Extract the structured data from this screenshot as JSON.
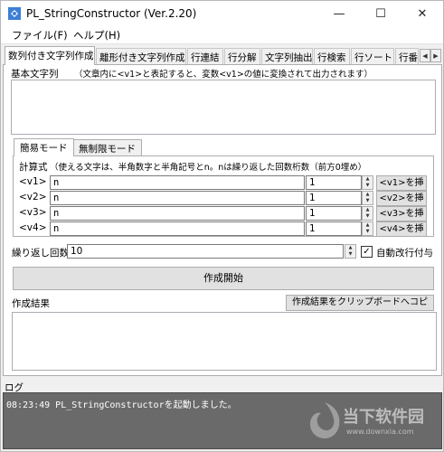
{
  "window": {
    "title": "PL_StringConstructor (Ver.2.20)",
    "minimize": "—",
    "maximize": "☐",
    "close": "✕"
  },
  "menu": {
    "file": "ファイル(F)",
    "help": "ヘルプ(H)"
  },
  "tabs": [
    "数列付き文字列作成",
    "離形付き文字列作成",
    "行連結",
    "行分解",
    "文字列抽出",
    "行検索",
    "行ソート",
    "行番"
  ],
  "main": {
    "base_label": "基本文字列",
    "base_hint": "（文章内に<v1>と表記すると、変数<v1>の値に変換されて出力されます）",
    "base_value": "",
    "mode_tabs": [
      "簡易モード",
      "無制限モード"
    ],
    "formula_label": "計算式",
    "formula_hint": "（使える文字は、半角数字と半角記号とn。nは繰り返した回数桁数（前方0埋め）",
    "vars": [
      {
        "label": "<v1> =",
        "formula": "n",
        "digits": "1",
        "insert": "<v1>を挿"
      },
      {
        "label": "<v2> =",
        "formula": "n",
        "digits": "1",
        "insert": "<v2>を挿"
      },
      {
        "label": "<v3> =",
        "formula": "n",
        "digits": "1",
        "insert": "<v3>を挿"
      },
      {
        "label": "<v4> =",
        "formula": "n",
        "digits": "1",
        "insert": "<v4>を挿"
      }
    ],
    "repeat_label": "繰り返し回数",
    "repeat_value": "10",
    "auto_newline_label": "自動改行付与",
    "auto_newline_checked": "✓",
    "create_button": "作成開始",
    "result_label": "作成結果",
    "copy_button": "作成結果をクリップボードへコピ",
    "result_value": ""
  },
  "log": {
    "label": "ログ",
    "lines": [
      "08:23:49 PL_StringConstructorを起動しました。"
    ]
  },
  "watermark": {
    "text_cn": "当下软件园",
    "text_url": "www.downxia.com"
  },
  "colors": {
    "log_bg": "#6a6a6a",
    "app_icon": "#3c7fd6"
  }
}
